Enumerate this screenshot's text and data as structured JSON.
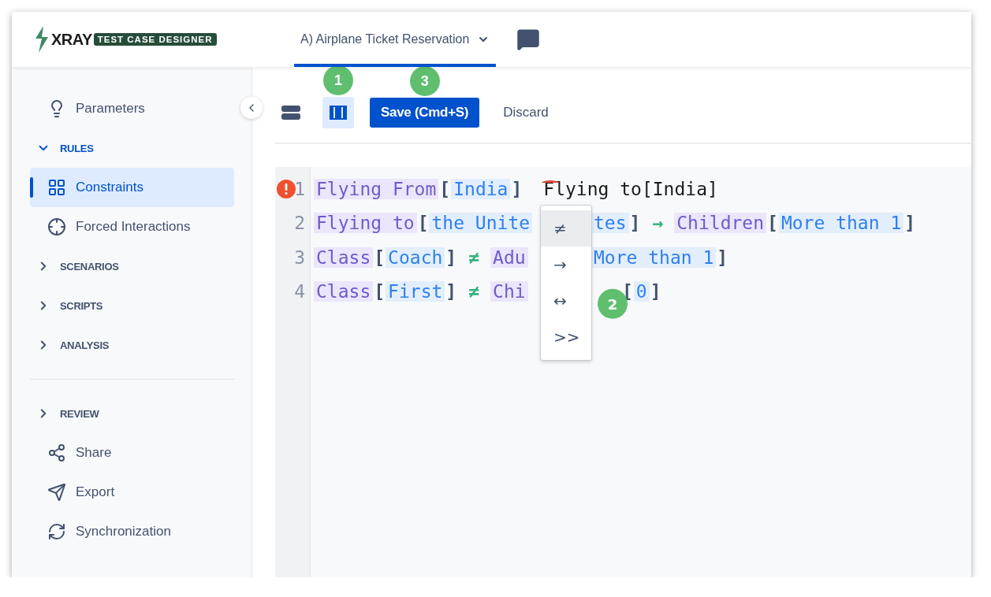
{
  "header": {
    "logo": {
      "name": "XRAY",
      "tagline": "TEST CASE DESIGNER"
    },
    "tabs": [
      {
        "label": "A) Airplane Ticket Reservation",
        "selected": true
      }
    ]
  },
  "sidebar": {
    "items": [
      {
        "kind": "link",
        "label": "Parameters",
        "selected": false
      },
      {
        "kind": "section",
        "label": "RULES",
        "expanded": true
      },
      {
        "kind": "link",
        "label": "Constraints",
        "selected": true
      },
      {
        "kind": "link",
        "label": "Forced Interactions",
        "selected": false
      },
      {
        "kind": "section",
        "label": "SCENARIOS",
        "expanded": false
      },
      {
        "kind": "section",
        "label": "SCRIPTS",
        "expanded": false
      },
      {
        "kind": "section",
        "label": "ANALYSIS",
        "expanded": false
      },
      {
        "kind": "divider"
      },
      {
        "kind": "section",
        "label": "REVIEW",
        "expanded": false
      },
      {
        "kind": "link",
        "label": "Share",
        "selected": false
      },
      {
        "kind": "link",
        "label": "Export",
        "selected": false
      },
      {
        "kind": "link",
        "label": "Synchronization",
        "selected": false
      }
    ]
  },
  "toolbar": {
    "views": [
      {
        "selected": false
      },
      {
        "selected": true,
        "marker": "1"
      }
    ],
    "save": {
      "label": "Save (Cmd+S)",
      "marker": "3"
    },
    "discard": {
      "label": "Discard"
    }
  },
  "editor": {
    "lines": [
      {
        "number": "1",
        "error": true,
        "tokens": [
          {
            "kind": "param",
            "text": "Flying From"
          },
          {
            "kind": "bracket",
            "text": "["
          },
          {
            "kind": "value",
            "text": "India"
          },
          {
            "kind": "bracket",
            "text": "]"
          },
          {
            "kind": "plain",
            "text": "Flying to[India]",
            "flagged": true
          }
        ]
      },
      {
        "number": "2",
        "error": false,
        "tokens": [
          {
            "kind": "param",
            "text": "Flying to"
          },
          {
            "kind": "bracket",
            "text": "["
          },
          {
            "kind": "value",
            "text": "the Unite",
            "covered": true
          },
          {
            "kind": "value",
            "text": "tes"
          },
          {
            "kind": "bracket",
            "text": "]"
          },
          {
            "kind": "operator",
            "text": "→"
          },
          {
            "kind": "param",
            "text": "Children"
          },
          {
            "kind": "bracket",
            "text": "["
          },
          {
            "kind": "value",
            "text": "More than 1"
          },
          {
            "kind": "bracket",
            "text": "]"
          }
        ]
      },
      {
        "number": "3",
        "error": false,
        "tokens": [
          {
            "kind": "param",
            "text": "Class"
          },
          {
            "kind": "bracket",
            "text": "["
          },
          {
            "kind": "value",
            "text": "Coach"
          },
          {
            "kind": "bracket",
            "text": "]"
          },
          {
            "kind": "operator",
            "text": "≠"
          },
          {
            "kind": "param",
            "text": "Adu",
            "covered": true
          },
          {
            "kind": "value",
            "text": "More than 1"
          },
          {
            "kind": "bracket",
            "text": "]"
          }
        ]
      },
      {
        "number": "4",
        "error": false,
        "tokens": [
          {
            "kind": "param",
            "text": "Class"
          },
          {
            "kind": "bracket",
            "text": "["
          },
          {
            "kind": "value",
            "text": "First"
          },
          {
            "kind": "bracket",
            "text": "]"
          },
          {
            "kind": "operator",
            "text": "≠"
          },
          {
            "kind": "param",
            "text": "Chi",
            "covered": true
          },
          {
            "kind": "bracket",
            "text": "["
          },
          {
            "kind": "value",
            "text": "0"
          },
          {
            "kind": "bracket",
            "text": "]"
          }
        ]
      }
    ],
    "operator_menu": {
      "items": [
        {
          "symbol": "≠",
          "selected": true
        },
        {
          "symbol": "→",
          "selected": false
        },
        {
          "symbol": "↔",
          "selected": false,
          "marker": "2"
        },
        {
          "symbol": ">>",
          "selected": false
        }
      ]
    }
  }
}
